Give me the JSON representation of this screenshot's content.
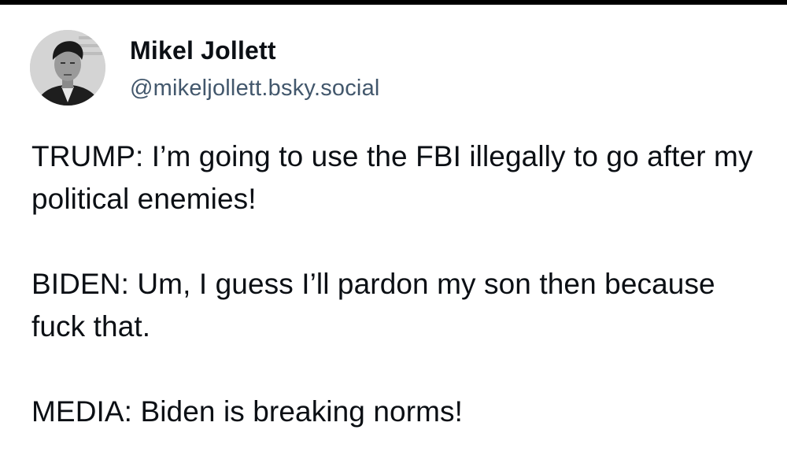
{
  "author": {
    "display_name": "Mikel Jollett",
    "handle": "@mikeljollett.bsky.social",
    "avatar_icon": "profile-photo-avatar"
  },
  "post": {
    "paragraphs": [
      "TRUMP: I’m going to use the FBI illegally to go after my political enemies!",
      "BIDEN: Um, I guess I’ll pardon my son then because fuck that.",
      "MEDIA: Biden is breaking norms!"
    ]
  },
  "colors": {
    "text": "#0b0f14",
    "handle": "#42576c",
    "background": "#ffffff",
    "top_border": "#000000"
  }
}
